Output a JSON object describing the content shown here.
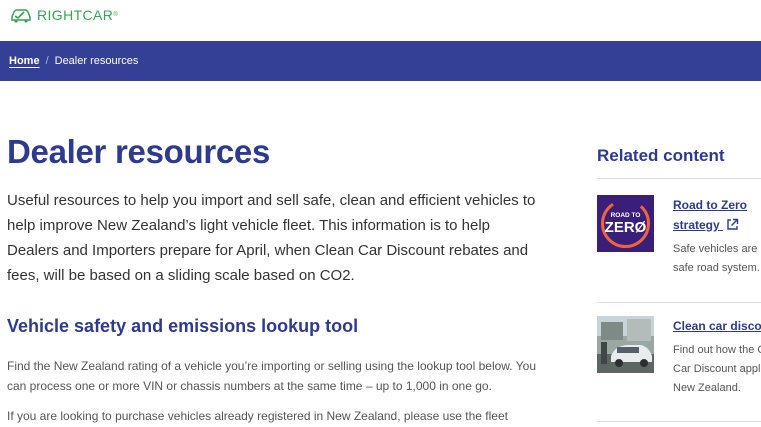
{
  "header": {
    "logo_text": "RIGHTCAR",
    "logo_tm": "®"
  },
  "breadcrumb": {
    "home": "Home",
    "separator": "/",
    "current": "Dealer resources"
  },
  "main": {
    "title": "Dealer resources",
    "intro": "Useful resources to help you import and sell safe, clean and efficient vehicles to help improve New Zealand’s light vehicle fleet. This information is to help Dealers and Importers prepare for April, when Clean Car Discount rebates and fees, will be based on a sliding scale based on CO2.",
    "section_title": "Vehicle safety and emissions lookup tool",
    "para1": "Find the New Zealand rating of a vehicle you’re importing or selling using the lookup tool below. You can process one or more VIN or chassis numbers at the same time – up to 1,000 in one go.",
    "para2": "If you are looking to purchase vehicles already registered in New Zealand, please use the fleet"
  },
  "sidebar": {
    "title": "Related content",
    "cards": [
      {
        "link_line1": "Road to Zero",
        "link_line2": "strategy",
        "desc_line1": "Safe vehicles are pa",
        "desc_line2": "safe road system.",
        "thumb_text_top": "ROAD TO",
        "thumb_text_main": "ZERØ",
        "icon": "external-link-icon"
      },
      {
        "link_line1": "Clean car discou",
        "desc_line1": "Find out how the Cl",
        "desc_line2": "Car Discount applie",
        "desc_line3": "New Zealand.",
        "icon": "car-photo"
      }
    ]
  },
  "colors": {
    "brand_blue": "#343f96",
    "heading_blue": "#2e3a8c",
    "logo_green": "#3aa15a",
    "rtz_purple": "#3a1f7a",
    "rtz_accent": "#f0643c"
  }
}
